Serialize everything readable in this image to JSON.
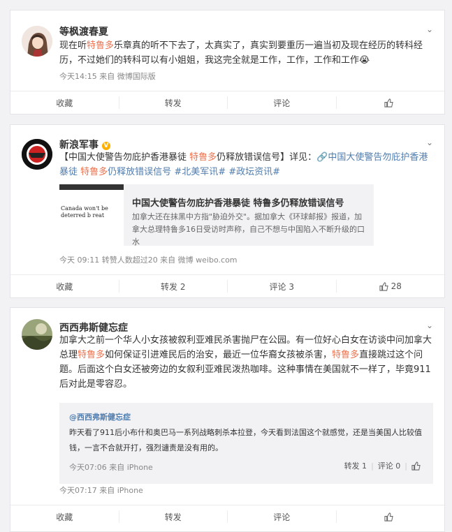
{
  "post1": {
    "user": "等枫渡春夏",
    "text_a": "现在听",
    "text_hl": "特鲁多",
    "text_b": "乐章真的听不下去了，太真实了，真实到要重历一遍当初及现在经历的转科经历，不过她们的转科可以有小姐姐，我这完全就是工作，工作，工作和工作",
    "emoji": "😭",
    "meta": "今天14:15  来自 微博国际版",
    "actions": {
      "fav": "收藏",
      "repost": "转发",
      "comment": "评论"
    }
  },
  "post2": {
    "user": "新浪军事",
    "verified_badge": "V",
    "text_a": "【中国大使警告勿庇护香港暴徒 ",
    "text_hl": "特鲁多",
    "text_b": "仍释放错误信号】详见：",
    "link": "🔗中国大使警告勿庇护香港暴徒 ",
    "link_hl": "特鲁多",
    "link_b": "仍释放错误信号",
    "tag1": "#北美军讯#",
    "tag2": "#政坛资讯#",
    "card_title": "中国大使警告勿庇护香港暴徒 特鲁多仍释放错误信号",
    "card_desc": "加拿大还在抹黑中方指\"胁迫外交\"。据加拿大《环球邮报》报道，加拿大总理特鲁多16日受访时声称，自己不想与中国陷入不断升级的口水",
    "card_img_text": "Canada won't be deterred b reat",
    "meta": "今天 09:11  转赞人数超过20  来自 微博 weibo.com",
    "actions": {
      "fav": "收藏",
      "repost": "转发 2",
      "comment": "评论 3",
      "like": "28"
    }
  },
  "post3": {
    "user": "西西弗斯健忘症",
    "text_a": "加拿大之前一个华人小女孩被叙利亚难民杀害抛尸在公园。有一位好心白女在访谈中问加拿大总理",
    "text_hl1": "特鲁多",
    "text_b": "如何保证引进难民后的治安，最近一位华裔女孩被杀害，",
    "text_hl2": "特鲁多",
    "text_c": "直接跳过这个问题。后面这个白女还被旁边的女叙利亚难民泼热咖啡。这种事情在美国就不一样了，毕竟911后对此是零容忍。",
    "quote": {
      "user": "@西西弗斯健忘症",
      "text": "昨天看了911后小布什和奥巴马一系列战略刺杀本拉登，今天看到法国这个就感觉，还是当美国人比较值钱，一言不合就开打，强烈谴责是没有用的。",
      "meta": "今天07:06  来自 iPhone",
      "repost": "转发 1",
      "comment": "评论 0"
    },
    "meta": "今天07:17  来自 iPhone",
    "actions": {
      "fav": "收藏",
      "repost": "转发",
      "comment": "评论"
    }
  },
  "colors": {
    "highlight": "#eb7350",
    "link": "#507daf",
    "verified": "#ffb000"
  }
}
